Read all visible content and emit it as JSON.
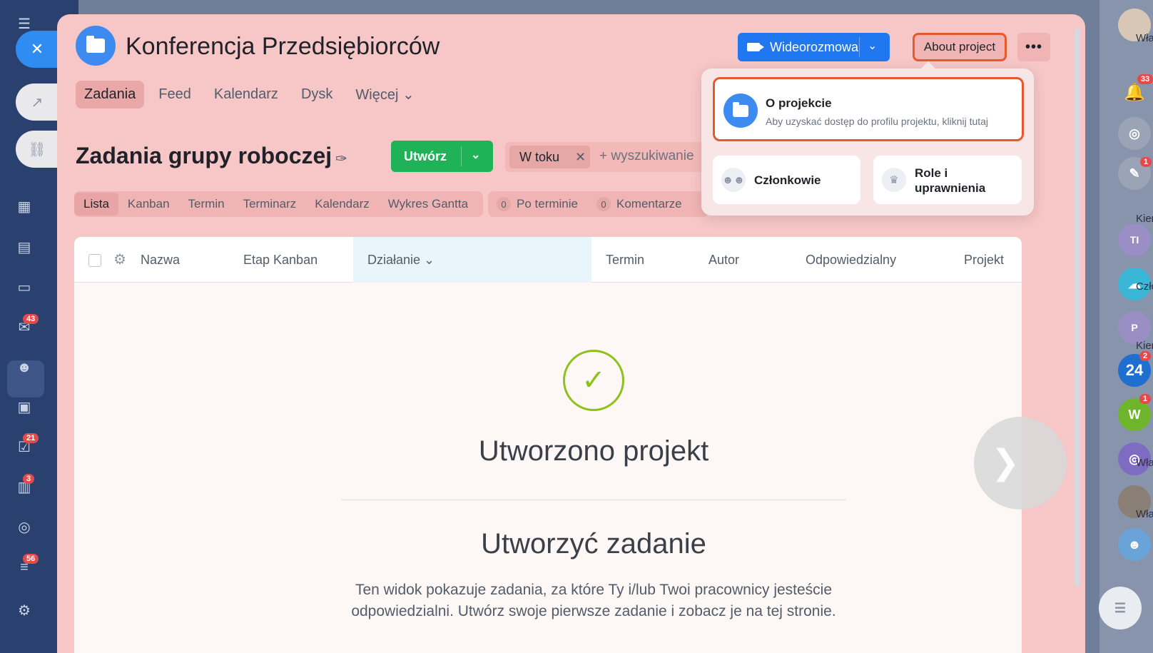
{
  "project": {
    "title": "Konferencja Przedsiębiorców",
    "video_button": "Wideorozmowa",
    "about_button": "About project"
  },
  "tabs": [
    {
      "label": "Zadania",
      "active": true
    },
    {
      "label": "Feed"
    },
    {
      "label": "Kalendarz"
    },
    {
      "label": "Dysk"
    },
    {
      "label": "Więcej ⌄"
    }
  ],
  "page": {
    "heading": "Zadania grupy roboczej",
    "create_button": "Utwórz",
    "filter_chip": "W toku",
    "search_placeholder": "+ wyszukiwanie"
  },
  "views": [
    "Lista",
    "Kanban",
    "Termin",
    "Terminarz",
    "Kalendarz",
    "Wykres Gantta"
  ],
  "counters": [
    {
      "count": "0",
      "label": "Po terminie"
    },
    {
      "count": "0",
      "label": "Komentarze"
    }
  ],
  "table": {
    "columns": [
      "Nazwa",
      "Etap Kanban",
      "Działanie ⌄",
      "Termin",
      "Autor",
      "Odpowiedzialny",
      "Projekt"
    ]
  },
  "empty_state": {
    "title": "Utworzono projekt",
    "subtitle": "Utworzyć zadanie",
    "description": "Ten widok pokazuje zadania, za które Ty i/lub Twoi pracownicy jesteście odpowiedzialni. Utwórz swoje pierwsze zadanie i zobacz je na tej stronie."
  },
  "popup": {
    "about_title": "O projekcie",
    "about_subtitle": "Aby uzyskać dostęp do profilu projektu, kliknij tutaj",
    "members": "Członkowie",
    "roles": "Role i uprawnienia"
  },
  "left_sidebar": {
    "badges": {
      "mail": "43",
      "tasks": "21",
      "contacts": "3",
      "filter": "56"
    }
  },
  "right_sidebar": {
    "notif_badge": "33",
    "chat_badge": "1",
    "b24_badge": "2",
    "w_badge": "1",
    "labels": {
      "top": "Wła",
      "kier1": "Kier",
      "tl_initials": "TI",
      "czl": "Czło",
      "p_initials": "P",
      "kier2": "Kier",
      "wla2": "Wła",
      "wla3": "Wła"
    },
    "b24_label": "24",
    "w_label": "W"
  },
  "colors": {
    "accent_blue": "#2077f0",
    "create_green": "#20b257",
    "highlight_orange": "#e45a2c",
    "panel_pink": "#f7c6c6",
    "check_green": "#8ec21b"
  }
}
